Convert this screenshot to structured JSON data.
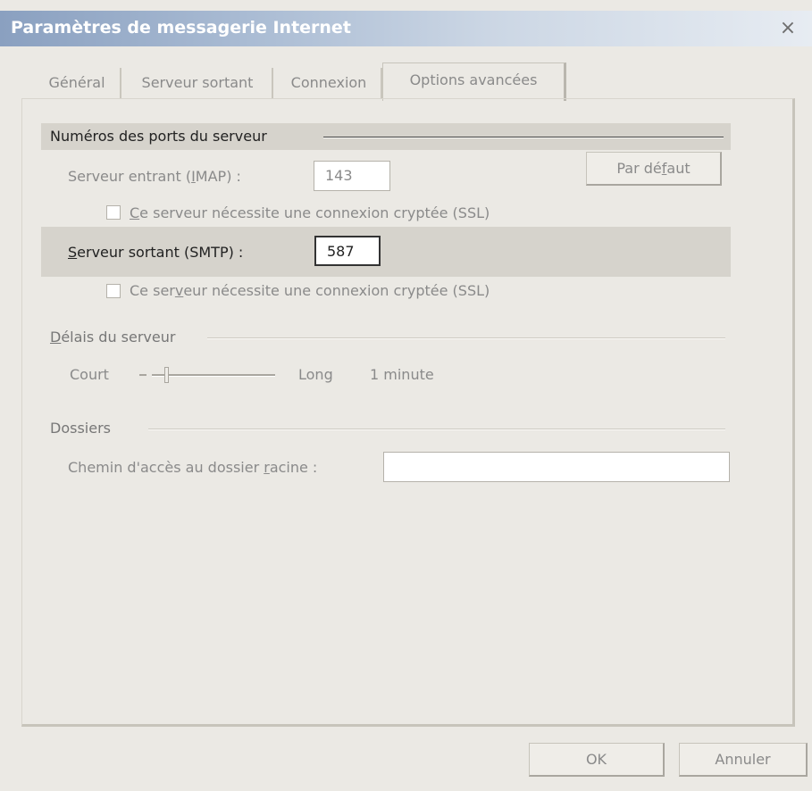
{
  "window": {
    "title": "Paramètres de messagerie Internet",
    "close_glyph": "×"
  },
  "tabs": [
    {
      "label": "Général",
      "active": false
    },
    {
      "label": "Serveur sortant",
      "active": false
    },
    {
      "label": "Connexion",
      "active": false
    },
    {
      "label": "Options avancées",
      "active": true
    }
  ],
  "ports": {
    "group_label": "Numéros des ports du serveur",
    "incoming_label_pre": "Serveur entrant (",
    "incoming_label_u": "I",
    "incoming_label_post": "MAP) :",
    "incoming_value": "143",
    "incoming_ssl_pre": "",
    "incoming_ssl_u": "C",
    "incoming_ssl_post": "e serveur nécessite une connexion cryptée (SSL)",
    "default_button_pre": "Par dé",
    "default_button_u": "f",
    "default_button_post": "aut",
    "outgoing_label_u": "S",
    "outgoing_label_post": "erveur sortant (SMTP) :",
    "outgoing_value": "587",
    "outgoing_ssl_pre": "Ce ser",
    "outgoing_ssl_u": "v",
    "outgoing_ssl_post": "eur nécessite une connexion cryptée (SSL)"
  },
  "timeouts": {
    "group_label_u": "D",
    "group_label_post": "élais du serveur",
    "short_label": "Court",
    "long_label": "Long",
    "value_text": "1 minute",
    "slider_position": 0.1
  },
  "folders": {
    "group_label": "Dossiers",
    "root_label_pre": "Chemin d'accès au dossier ",
    "root_label_u": "r",
    "root_label_post": "acine :",
    "root_value": ""
  },
  "footer": {
    "ok_label": "OK",
    "cancel_label": "Annuler"
  }
}
